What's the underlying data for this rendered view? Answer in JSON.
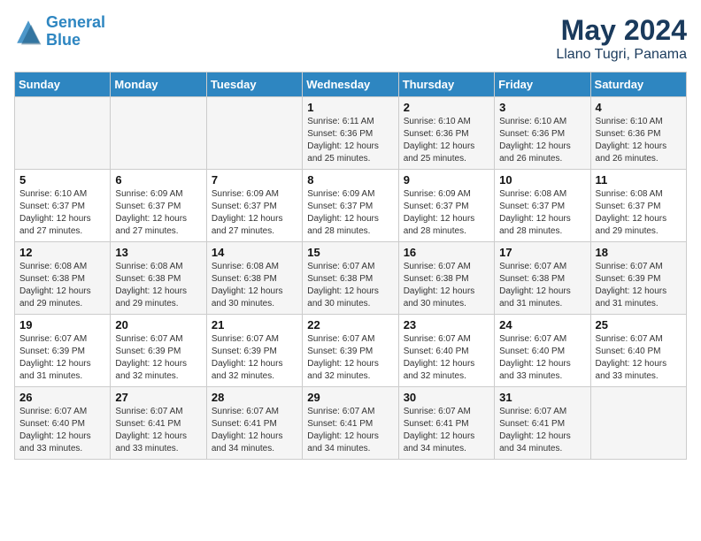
{
  "logo": {
    "line1": "General",
    "line2": "Blue"
  },
  "title": "May 2024",
  "subtitle": "Llano Tugri, Panama",
  "days_of_week": [
    "Sunday",
    "Monday",
    "Tuesday",
    "Wednesday",
    "Thursday",
    "Friday",
    "Saturday"
  ],
  "weeks": [
    [
      {
        "day": "",
        "info": ""
      },
      {
        "day": "",
        "info": ""
      },
      {
        "day": "",
        "info": ""
      },
      {
        "day": "1",
        "info": "Sunrise: 6:11 AM\nSunset: 6:36 PM\nDaylight: 12 hours\nand 25 minutes."
      },
      {
        "day": "2",
        "info": "Sunrise: 6:10 AM\nSunset: 6:36 PM\nDaylight: 12 hours\nand 25 minutes."
      },
      {
        "day": "3",
        "info": "Sunrise: 6:10 AM\nSunset: 6:36 PM\nDaylight: 12 hours\nand 26 minutes."
      },
      {
        "day": "4",
        "info": "Sunrise: 6:10 AM\nSunset: 6:36 PM\nDaylight: 12 hours\nand 26 minutes."
      }
    ],
    [
      {
        "day": "5",
        "info": "Sunrise: 6:10 AM\nSunset: 6:37 PM\nDaylight: 12 hours\nand 27 minutes."
      },
      {
        "day": "6",
        "info": "Sunrise: 6:09 AM\nSunset: 6:37 PM\nDaylight: 12 hours\nand 27 minutes."
      },
      {
        "day": "7",
        "info": "Sunrise: 6:09 AM\nSunset: 6:37 PM\nDaylight: 12 hours\nand 27 minutes."
      },
      {
        "day": "8",
        "info": "Sunrise: 6:09 AM\nSunset: 6:37 PM\nDaylight: 12 hours\nand 28 minutes."
      },
      {
        "day": "9",
        "info": "Sunrise: 6:09 AM\nSunset: 6:37 PM\nDaylight: 12 hours\nand 28 minutes."
      },
      {
        "day": "10",
        "info": "Sunrise: 6:08 AM\nSunset: 6:37 PM\nDaylight: 12 hours\nand 28 minutes."
      },
      {
        "day": "11",
        "info": "Sunrise: 6:08 AM\nSunset: 6:37 PM\nDaylight: 12 hours\nand 29 minutes."
      }
    ],
    [
      {
        "day": "12",
        "info": "Sunrise: 6:08 AM\nSunset: 6:38 PM\nDaylight: 12 hours\nand 29 minutes."
      },
      {
        "day": "13",
        "info": "Sunrise: 6:08 AM\nSunset: 6:38 PM\nDaylight: 12 hours\nand 29 minutes."
      },
      {
        "day": "14",
        "info": "Sunrise: 6:08 AM\nSunset: 6:38 PM\nDaylight: 12 hours\nand 30 minutes."
      },
      {
        "day": "15",
        "info": "Sunrise: 6:07 AM\nSunset: 6:38 PM\nDaylight: 12 hours\nand 30 minutes."
      },
      {
        "day": "16",
        "info": "Sunrise: 6:07 AM\nSunset: 6:38 PM\nDaylight: 12 hours\nand 30 minutes."
      },
      {
        "day": "17",
        "info": "Sunrise: 6:07 AM\nSunset: 6:38 PM\nDaylight: 12 hours\nand 31 minutes."
      },
      {
        "day": "18",
        "info": "Sunrise: 6:07 AM\nSunset: 6:39 PM\nDaylight: 12 hours\nand 31 minutes."
      }
    ],
    [
      {
        "day": "19",
        "info": "Sunrise: 6:07 AM\nSunset: 6:39 PM\nDaylight: 12 hours\nand 31 minutes."
      },
      {
        "day": "20",
        "info": "Sunrise: 6:07 AM\nSunset: 6:39 PM\nDaylight: 12 hours\nand 32 minutes."
      },
      {
        "day": "21",
        "info": "Sunrise: 6:07 AM\nSunset: 6:39 PM\nDaylight: 12 hours\nand 32 minutes."
      },
      {
        "day": "22",
        "info": "Sunrise: 6:07 AM\nSunset: 6:39 PM\nDaylight: 12 hours\nand 32 minutes."
      },
      {
        "day": "23",
        "info": "Sunrise: 6:07 AM\nSunset: 6:40 PM\nDaylight: 12 hours\nand 32 minutes."
      },
      {
        "day": "24",
        "info": "Sunrise: 6:07 AM\nSunset: 6:40 PM\nDaylight: 12 hours\nand 33 minutes."
      },
      {
        "day": "25",
        "info": "Sunrise: 6:07 AM\nSunset: 6:40 PM\nDaylight: 12 hours\nand 33 minutes."
      }
    ],
    [
      {
        "day": "26",
        "info": "Sunrise: 6:07 AM\nSunset: 6:40 PM\nDaylight: 12 hours\nand 33 minutes."
      },
      {
        "day": "27",
        "info": "Sunrise: 6:07 AM\nSunset: 6:41 PM\nDaylight: 12 hours\nand 33 minutes."
      },
      {
        "day": "28",
        "info": "Sunrise: 6:07 AM\nSunset: 6:41 PM\nDaylight: 12 hours\nand 34 minutes."
      },
      {
        "day": "29",
        "info": "Sunrise: 6:07 AM\nSunset: 6:41 PM\nDaylight: 12 hours\nand 34 minutes."
      },
      {
        "day": "30",
        "info": "Sunrise: 6:07 AM\nSunset: 6:41 PM\nDaylight: 12 hours\nand 34 minutes."
      },
      {
        "day": "31",
        "info": "Sunrise: 6:07 AM\nSunset: 6:41 PM\nDaylight: 12 hours\nand 34 minutes."
      },
      {
        "day": "",
        "info": ""
      }
    ]
  ]
}
